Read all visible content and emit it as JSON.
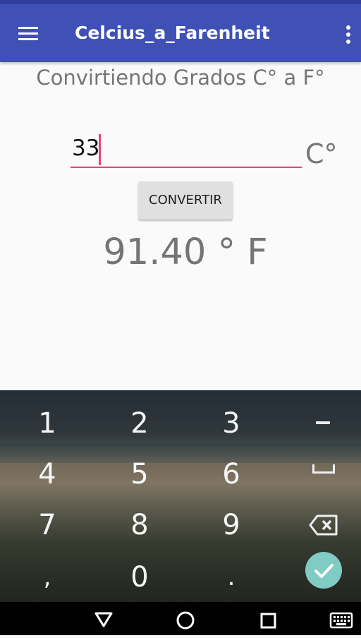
{
  "app_bar": {
    "title": "Celcius_a_Farenheit",
    "color": "#3f51b5",
    "menu_icon": "hamburger-menu-icon",
    "overflow_icon": "more-vert-icon"
  },
  "main": {
    "heading": "Convirtiendo Grados C° a F°",
    "input_value": "33",
    "unit_label": "C°",
    "convert_label": "CONVERTIR",
    "result": "91.40 ° F",
    "accent": "#ec407a"
  },
  "keyboard": {
    "rows": [
      [
        "1",
        "2",
        "3",
        "-"
      ],
      [
        "4",
        "5",
        "6",
        "space"
      ],
      [
        "7",
        "8",
        "9",
        "backspace"
      ],
      [
        ",",
        "0",
        ".",
        "done"
      ]
    ],
    "done_color": "#80cbc4"
  },
  "nav_bar": {
    "buttons": [
      "back-icon",
      "home-icon",
      "recents-icon",
      "keyboard-icon"
    ]
  }
}
